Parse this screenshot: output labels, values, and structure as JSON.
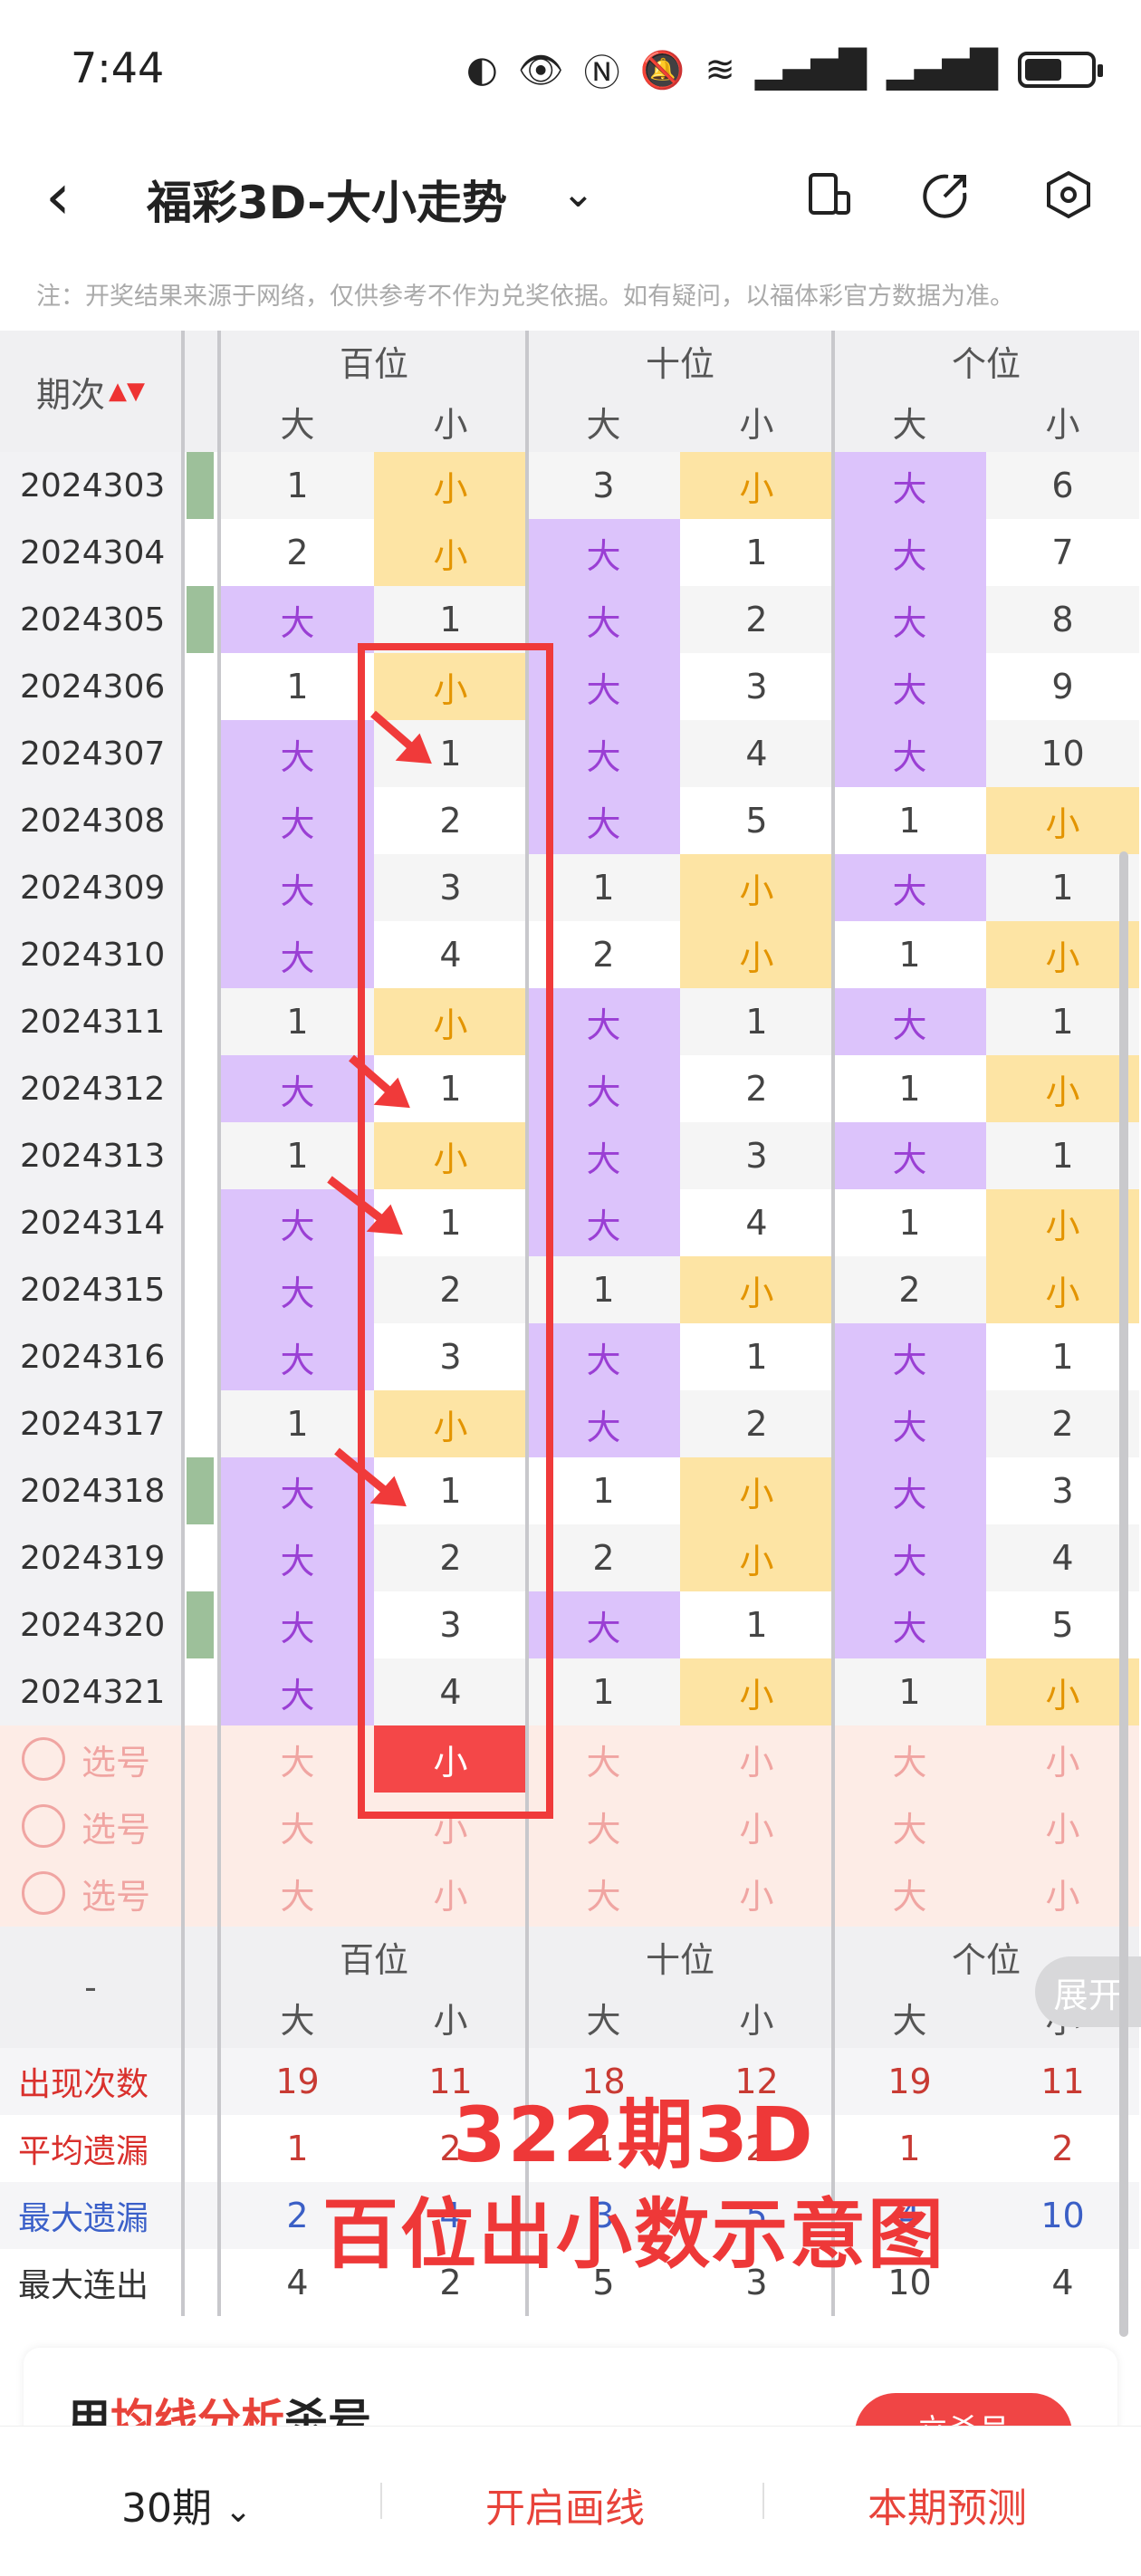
{
  "status": {
    "time": "7:44",
    "battery_icon": "battery-icon"
  },
  "header": {
    "title": "福彩3D-大小走势",
    "back_icon": "chevron-left-icon",
    "dropdown_icon": "chevron-down-icon",
    "icons": [
      "phone-layout-icon",
      "share-icon",
      "settings-hexagon-icon"
    ]
  },
  "note": "注：开奖结果来源于网络，仅供参考不作为兑奖依据。如有疑问，以福体彩官方数据为准。",
  "table": {
    "period_header": "期次",
    "groups": [
      "百位",
      "十位",
      "个位"
    ],
    "subheads": [
      "大",
      "小",
      "大",
      "小",
      "大",
      "小"
    ],
    "rows": [
      {
        "p": "2024303",
        "v": [
          "1",
          "小",
          "3",
          "小",
          "大",
          "6"
        ]
      },
      {
        "p": "2024304",
        "v": [
          "2",
          "小",
          "大",
          "1",
          "大",
          "7"
        ]
      },
      {
        "p": "2024305",
        "v": [
          "大",
          "1",
          "大",
          "2",
          "大",
          "8"
        ]
      },
      {
        "p": "2024306",
        "v": [
          "1",
          "小",
          "大",
          "3",
          "大",
          "9"
        ]
      },
      {
        "p": "2024307",
        "v": [
          "大",
          "1",
          "大",
          "4",
          "大",
          "10"
        ]
      },
      {
        "p": "2024308",
        "v": [
          "大",
          "2",
          "大",
          "5",
          "1",
          "小"
        ]
      },
      {
        "p": "2024309",
        "v": [
          "大",
          "3",
          "1",
          "小",
          "大",
          "1"
        ]
      },
      {
        "p": "2024310",
        "v": [
          "大",
          "4",
          "2",
          "小",
          "1",
          "小"
        ]
      },
      {
        "p": "2024311",
        "v": [
          "1",
          "小",
          "大",
          "1",
          "大",
          "1"
        ]
      },
      {
        "p": "2024312",
        "v": [
          "大",
          "1",
          "大",
          "2",
          "1",
          "小"
        ]
      },
      {
        "p": "2024313",
        "v": [
          "1",
          "小",
          "大",
          "3",
          "大",
          "1"
        ]
      },
      {
        "p": "2024314",
        "v": [
          "大",
          "1",
          "大",
          "4",
          "1",
          "小"
        ]
      },
      {
        "p": "2024315",
        "v": [
          "大",
          "2",
          "1",
          "小",
          "2",
          "小"
        ]
      },
      {
        "p": "2024316",
        "v": [
          "大",
          "3",
          "大",
          "1",
          "大",
          "1"
        ]
      },
      {
        "p": "2024317",
        "v": [
          "1",
          "小",
          "大",
          "2",
          "大",
          "2"
        ]
      },
      {
        "p": "2024318",
        "v": [
          "大",
          "1",
          "1",
          "小",
          "大",
          "3"
        ]
      },
      {
        "p": "2024319",
        "v": [
          "大",
          "2",
          "2",
          "小",
          "大",
          "4"
        ]
      },
      {
        "p": "2024320",
        "v": [
          "大",
          "3",
          "大",
          "1",
          "大",
          "5"
        ]
      },
      {
        "p": "2024321",
        "v": [
          "大",
          "4",
          "1",
          "小",
          "1",
          "小"
        ]
      }
    ],
    "pick_label": "选号",
    "pick_rows": [
      [
        "大",
        "小",
        "大",
        "小",
        "大",
        "小"
      ],
      [
        "大",
        "小",
        "大",
        "小",
        "大",
        "小"
      ],
      [
        "大",
        "小",
        "大",
        "小",
        "大",
        "小"
      ]
    ],
    "stats_header_label": "-",
    "stats": [
      {
        "label": "出现次数",
        "values": [
          "19",
          "11",
          "18",
          "12",
          "19",
          "11"
        ],
        "style": "red"
      },
      {
        "label": "平均遗漏",
        "values": [
          "1",
          "2",
          "1",
          "2",
          "1",
          "2"
        ],
        "style": "red"
      },
      {
        "label": "最大遗漏",
        "values": [
          "2",
          "4",
          "3",
          "5",
          "4",
          "10"
        ],
        "style": "blue"
      },
      {
        "label": "最大连出",
        "values": [
          "4",
          "2",
          "5",
          "3",
          "10",
          "4"
        ],
        "style": "dark"
      }
    ]
  },
  "annotation": {
    "line1": "322期3D",
    "line2": "百位出小数示意图"
  },
  "expand_label": "展开",
  "card": {
    "prefix": "用",
    "highlight": "均线分析",
    "suffix": "杀号",
    "button": "立杀号"
  },
  "bottom": {
    "periods": "30期",
    "draw_line": "开启画线",
    "predict": "本期预测"
  },
  "colors": {
    "big": "#dcc3fb",
    "small": "#fde4a4",
    "accent": "#f04545"
  }
}
